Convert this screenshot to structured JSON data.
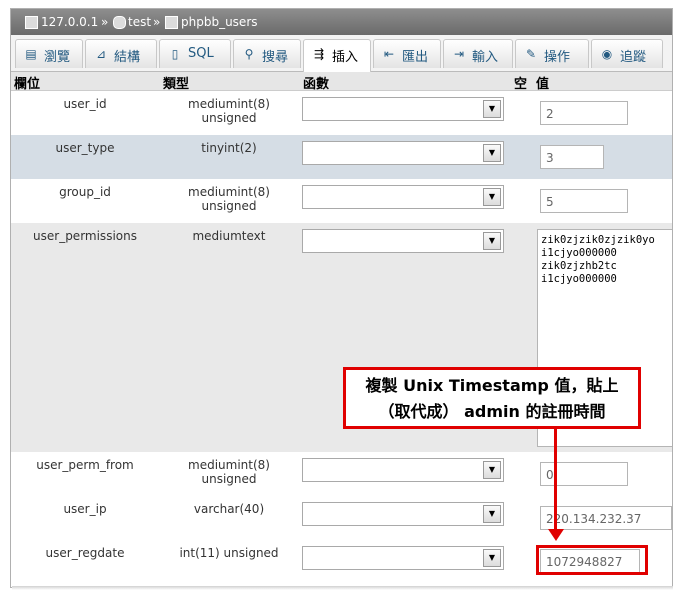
{
  "breadcrumb": {
    "server": "127.0.0.1",
    "sep": "»",
    "database": "test",
    "table": "phpbb_users"
  },
  "tabs": [
    {
      "label": "瀏覽",
      "icon": "browse-icon"
    },
    {
      "label": "結構",
      "icon": "structure-icon"
    },
    {
      "label": "SQL",
      "icon": "sql-icon"
    },
    {
      "label": "搜尋",
      "icon": "search-icon"
    },
    {
      "label": "插入",
      "icon": "insert-icon",
      "active": true
    },
    {
      "label": "匯出",
      "icon": "export-icon"
    },
    {
      "label": "輸入",
      "icon": "import-icon"
    },
    {
      "label": "操作",
      "icon": "operations-icon"
    },
    {
      "label": "追蹤",
      "icon": "tracking-icon"
    }
  ],
  "header": {
    "field": "欄位",
    "type": "類型",
    "function": "函數",
    "null": "空",
    "value": "值"
  },
  "rows": [
    {
      "name": "user_id",
      "type": "mediumint(8) unsigned",
      "value": "2"
    },
    {
      "name": "user_type",
      "type": "tinyint(2)",
      "value": "3"
    },
    {
      "name": "group_id",
      "type": "mediumint(8) unsigned",
      "value": "5"
    },
    {
      "name": "user_permissions",
      "type": "mediumtext",
      "value_lines": [
        "zik0zjzik0zjzik0yo",
        "i1cjyo000000",
        "zik0zjzhb2tc",
        "i1cjyo000000"
      ]
    },
    {
      "name": "user_perm_from",
      "type": "mediumint(8) unsigned",
      "value": "0"
    },
    {
      "name": "user_ip",
      "type": "varchar(40)",
      "value": "220.134.232.37"
    },
    {
      "name": "user_regdate",
      "type": "int(11) unsigned",
      "value": "1072948827"
    }
  ],
  "annotation": {
    "line1": "複製 Unix Timestamp 值，貼上",
    "line2": "（取代成） admin 的註冊時間",
    "color": "#e00000"
  }
}
